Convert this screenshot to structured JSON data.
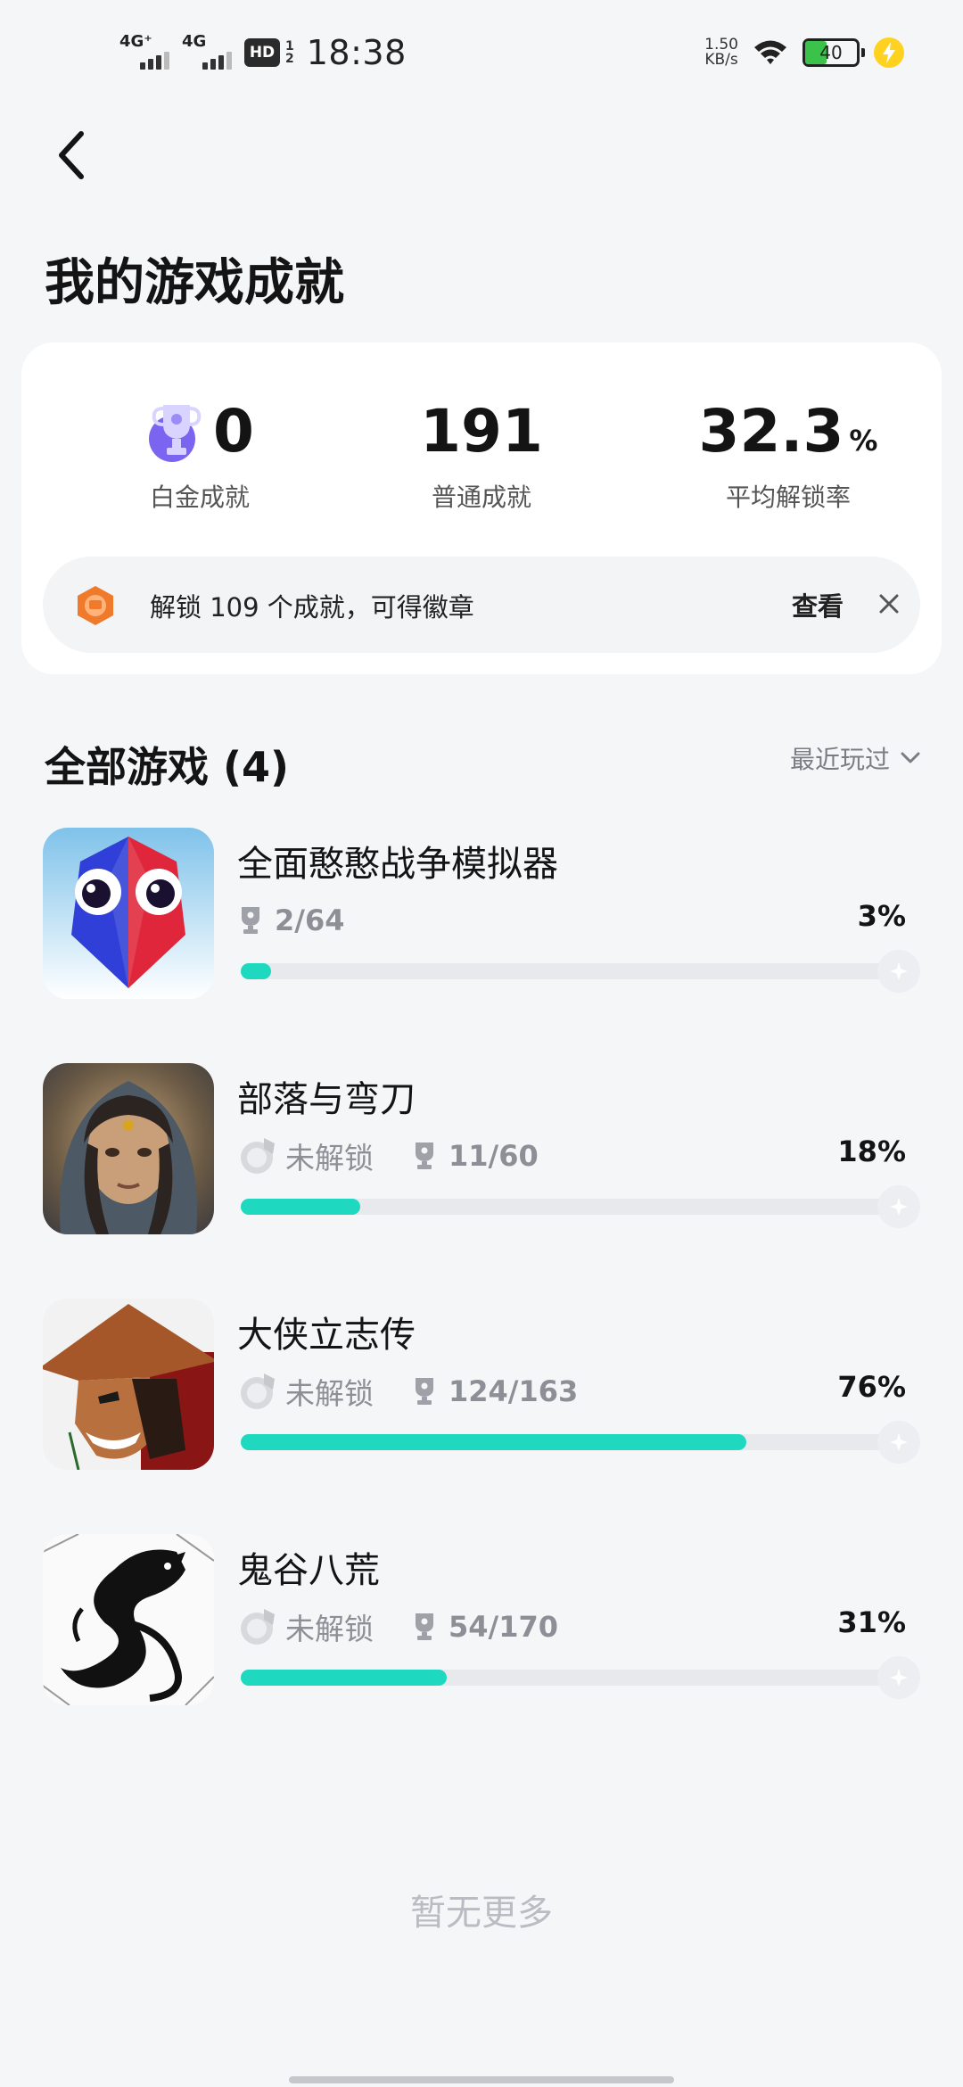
{
  "status_bar": {
    "signal1_label": "4G⁺",
    "signal2_label": "4G",
    "hd_label": "HD",
    "hd_fraction_top": "1",
    "hd_fraction_bottom": "2",
    "time": "18:38",
    "net_speed_value": "1.50",
    "net_speed_unit": "KB/s",
    "battery_level": "40"
  },
  "header": {
    "back_icon": "chevron-left-icon",
    "title": "我的游戏成就"
  },
  "summary": {
    "platinum": {
      "value": "0",
      "label": "白金成就",
      "icon": "platinum-trophy-icon"
    },
    "normal": {
      "value": "191",
      "label": "普通成就"
    },
    "rate": {
      "value": "32.3",
      "unit": "%",
      "label": "平均解锁率"
    },
    "banner": {
      "icon": "badge-medal-icon",
      "text": "解锁 109 个成就，可得徽章",
      "action": "查看",
      "close_icon": "close-icon"
    }
  },
  "games_section": {
    "title": "全部游戏 (4)",
    "sort_label": "最近玩过",
    "sort_icon": "chevron-down-icon"
  },
  "games": [
    {
      "name": "全面憨憨战争模拟器",
      "badge_status": "",
      "trophies": "2/64",
      "percent": "3%",
      "progress": 0.03
    },
    {
      "name": "部落与弯刀",
      "badge_status": "未解锁",
      "trophies": "11/60",
      "percent": "18%",
      "progress": 0.18
    },
    {
      "name": "大侠立志传",
      "badge_status": "未解锁",
      "trophies": "124/163",
      "percent": "76%",
      "progress": 0.76
    },
    {
      "name": "鬼谷八荒",
      "badge_status": "未解锁",
      "trophies": "54/170",
      "percent": "31%",
      "progress": 0.31
    }
  ],
  "footer": {
    "no_more": "暂无更多"
  },
  "colors": {
    "progress": "#1ed9c0",
    "track": "#e7e9ed",
    "background": "#f5f6f8",
    "badge_orange": "#f07a2c"
  }
}
